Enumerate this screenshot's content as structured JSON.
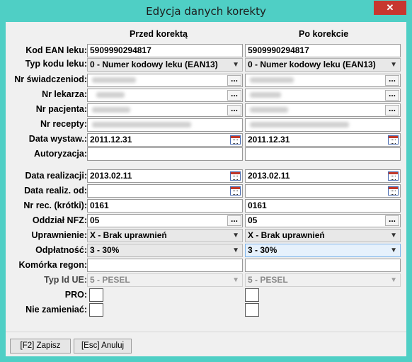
{
  "window": {
    "title": "Edycja danych korekty",
    "close_label": "✕"
  },
  "columns": {
    "before": "Przed korektą",
    "after": "Po korekcie"
  },
  "labels": {
    "ean": "Kod EAN leku:",
    "kod_type": "Typ kodu leku:",
    "nr_swiad": "Nr świadczeniod:",
    "nr_lekarza": "Nr lekarza:",
    "nr_pacjenta": "Nr pacjenta:",
    "nr_recepty": "Nr recepty:",
    "data_wystaw": "Data wystaw.:",
    "autoryzacja": "Autoryzacja:",
    "data_realizacji": "Data realizacji:",
    "data_realiz_od": "Data realiz. od:",
    "nr_rec_krotki": "Nr rec. (krótki):",
    "oddzial_nfz": "Oddział NFZ:",
    "uprawnienie": "Uprawnienie:",
    "odplatnosc": "Odpłatność:",
    "komorka_regon": "Komórka regon:",
    "typ_id_ue": "Typ Id UE:",
    "pro": "PRO:",
    "nie_zamieniac": "Nie zamieniać:"
  },
  "before": {
    "ean": "5909990294817",
    "kod_type": "0 - Numer kodowy leku (EAN13)",
    "data_wystaw": "2011.12.31",
    "autoryzacja": "",
    "data_realizacji": "2013.02.11",
    "data_realiz_od": "  .  .",
    "nr_rec_krotki": "0161",
    "oddzial_nfz": "05",
    "uprawnienie": "X - Brak uprawnień",
    "odplatnosc": "3 - 30%",
    "komorka_regon": "",
    "typ_id_ue": "5 - PESEL"
  },
  "after": {
    "ean": "5909990294817",
    "kod_type": "0 - Numer kodowy leku (EAN13)",
    "data_wystaw": "2011.12.31",
    "autoryzacja": "",
    "data_realizacji": "2013.02.11",
    "data_realiz_od": "  .  .",
    "nr_rec_krotki": "0161",
    "oddzial_nfz": "05",
    "uprawnienie": "X - Brak uprawnień",
    "odplatnosc": "3 - 30%",
    "komorka_regon": "",
    "typ_id_ue": "5 - PESEL"
  },
  "buttons": {
    "save": "[F2] Zapisz",
    "cancel": "[Esc] Anuluj",
    "browse": "..."
  },
  "icons": {
    "dropdown": "chevron-down-icon",
    "calendar": "calendar-icon",
    "close": "close-icon"
  },
  "colors": {
    "frame": "#4fcfc5",
    "close": "#c7372f",
    "focus": "#e6f1fc"
  }
}
